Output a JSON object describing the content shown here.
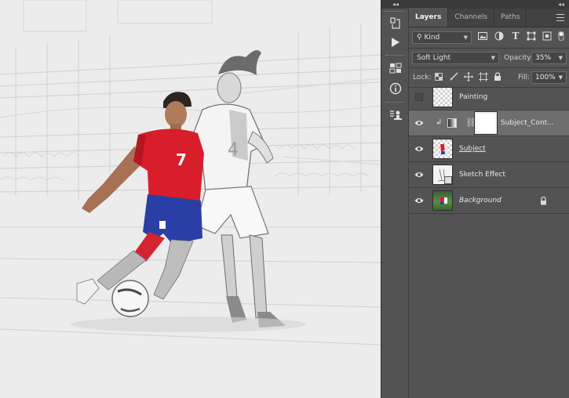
{
  "panel": {
    "collapse_glyph": "◂◂",
    "tabs": [
      {
        "label": "Layers",
        "active": true
      },
      {
        "label": "Channels",
        "active": false
      },
      {
        "label": "Paths",
        "active": false
      }
    ],
    "filter": {
      "kind_label": "Kind",
      "icon": "search-icon"
    },
    "blend": {
      "mode": "Soft Light",
      "opacity_label": "Opacity:",
      "opacity_value": "35%"
    },
    "lock": {
      "label": "Lock:",
      "fill_label": "Fill:",
      "fill_value": "100%"
    },
    "layers": [
      {
        "name": "Painting",
        "visible": false,
        "selected": false,
        "style": "normal"
      },
      {
        "name": "Subject_Cont...",
        "visible": true,
        "selected": true,
        "style": "normal",
        "clipped": true,
        "has_mask": true
      },
      {
        "name": "Subject",
        "visible": true,
        "selected": false,
        "style": "underline"
      },
      {
        "name": "Sketch Effect",
        "visible": true,
        "selected": false,
        "style": "normal"
      },
      {
        "name": "Background",
        "visible": true,
        "selected": false,
        "style": "italic",
        "locked": true
      }
    ]
  },
  "canvas": {
    "jersey_number_left": "7",
    "jersey_number_right": "4"
  },
  "colors": {
    "panel_bg": "#535353",
    "selected_row": "#6e6e6e",
    "jersey_red": "#d81e2a",
    "shorts_blue": "#2a3fa6"
  }
}
